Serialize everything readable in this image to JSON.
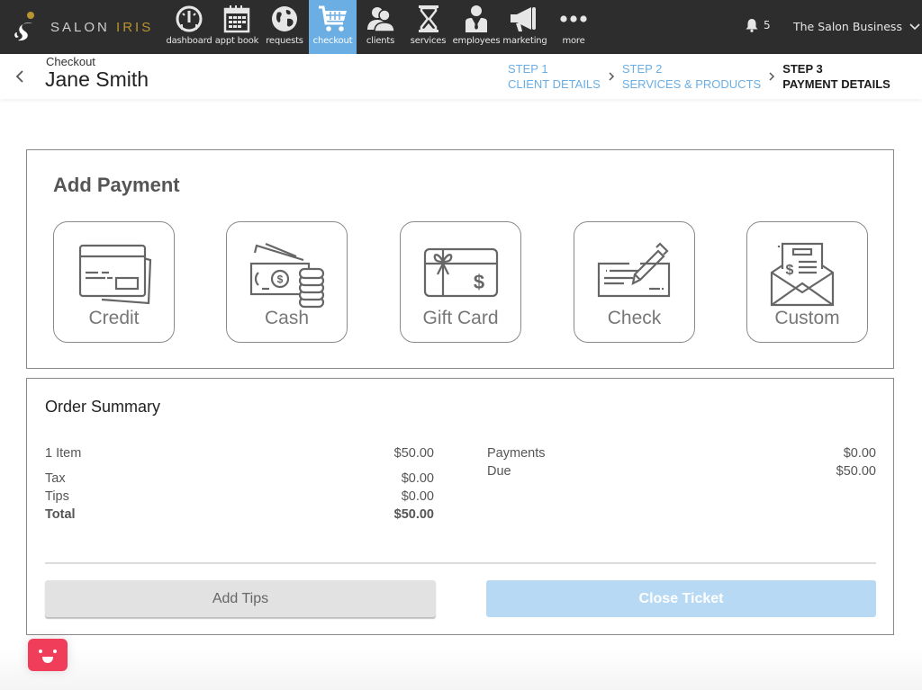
{
  "app": {
    "brand_primary": "SALON",
    "brand_secondary": "IRIS",
    "accent_color": "#6aaee4",
    "brand_gold": "#b8952e"
  },
  "nav": {
    "items": [
      {
        "label": "dashboard",
        "icon": "speedometer-icon",
        "active": false
      },
      {
        "label": "appt book",
        "icon": "calendar-icon",
        "active": false
      },
      {
        "label": "requests",
        "icon": "globe-icon",
        "active": false
      },
      {
        "label": "checkout",
        "icon": "cart-icon",
        "active": true
      },
      {
        "label": "clients",
        "icon": "users-icon",
        "active": false
      },
      {
        "label": "services",
        "icon": "hourglass-icon",
        "active": false
      },
      {
        "label": "employees",
        "icon": "employee-icon",
        "active": false
      },
      {
        "label": "marketing",
        "icon": "megaphone-icon",
        "active": false
      },
      {
        "label": "more",
        "icon": "ellipsis-icon",
        "active": false
      }
    ],
    "notifications_count": "5",
    "business_name": "The Salon Business"
  },
  "header": {
    "breadcrumb": "Checkout",
    "client_name": "Jane Smith",
    "steps": [
      {
        "step": "STEP 1",
        "label": "CLIENT DETAILS",
        "current": false
      },
      {
        "step": "STEP 2",
        "label": "SERVICES & PRODUCTS",
        "current": false
      },
      {
        "step": "STEP 3",
        "label": "PAYMENT DETAILS",
        "current": true
      }
    ]
  },
  "payment": {
    "title": "Add Payment",
    "methods": [
      {
        "label": "Credit",
        "icon": "credit-card-icon"
      },
      {
        "label": "Cash",
        "icon": "cash-icon"
      },
      {
        "label": "Gift Card",
        "icon": "gift-card-icon"
      },
      {
        "label": "Check",
        "icon": "check-icon"
      },
      {
        "label": "Custom",
        "icon": "envelope-invoice-icon"
      }
    ]
  },
  "summary": {
    "title": "Order Summary",
    "items_label": "1 Item",
    "items_value": "$50.00",
    "tax_label": "Tax",
    "tax_value": "$0.00",
    "tips_label": "Tips",
    "tips_value": "$0.00",
    "total_label": "Total",
    "total_value": "$50.00",
    "payments_label": "Payments",
    "payments_value": "$0.00",
    "due_label": "Due",
    "due_value": "$50.00",
    "add_tips_label": "Add Tips",
    "close_ticket_label": "Close Ticket"
  }
}
